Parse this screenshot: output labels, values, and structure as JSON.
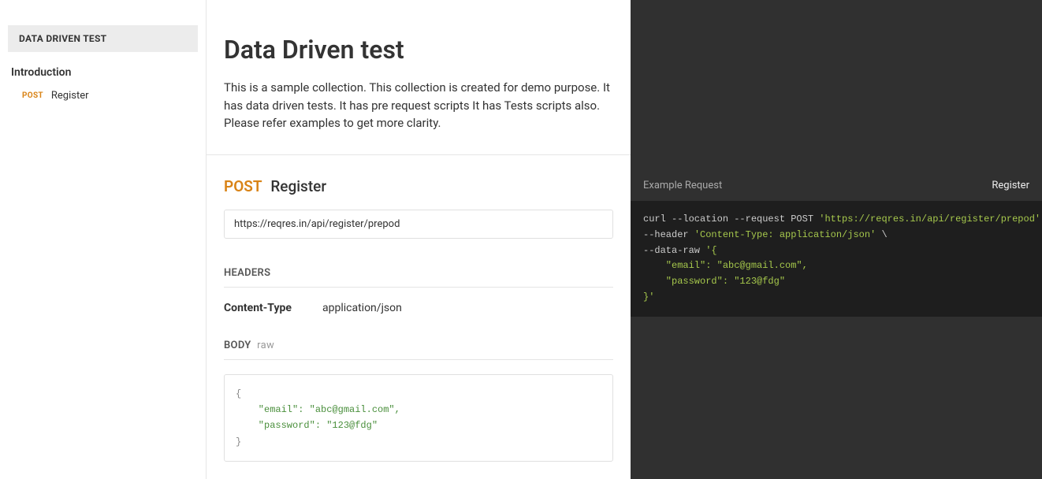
{
  "sidebar": {
    "title": "DATA DRIVEN TEST",
    "group_label": "Introduction",
    "items": [
      {
        "method": "POST",
        "label": "Register"
      }
    ]
  },
  "main": {
    "title": "Data Driven test",
    "description": "This is a sample collection. This collection is created for demo purpose. It has data driven tests. It has pre request scripts It has Tests scripts also. Please refer examples to get more clarity."
  },
  "endpoint": {
    "method": "POST",
    "name": "Register",
    "url": "https://reqres.in/api/register/prepod",
    "headers_label": "HEADERS",
    "headers": [
      {
        "key": "Content-Type",
        "value": "application/json"
      }
    ],
    "body_label": "BODY",
    "body_suffix": "raw",
    "body_lines": {
      "l0": "{",
      "l1": "    \"email\": \"abc@gmail.com\",",
      "l2": "    \"password\": \"123@fdg\"",
      "l3": "}"
    }
  },
  "example": {
    "left_label": "Example Request",
    "right_label": "Register",
    "code": {
      "l0a": "curl --location --request POST ",
      "l0b": "'https://reqres.in/api/register/prepod'",
      "l0c": " \\",
      "l1a": "--header ",
      "l1b": "'Content-Type: application/json'",
      "l1c": " \\",
      "l2a": "--data-raw ",
      "l2b": "'{",
      "l3": "    \"email\": \"abc@gmail.com\",",
      "l4": "    \"password\": \"123@fdg\"",
      "l5": "}'"
    }
  }
}
